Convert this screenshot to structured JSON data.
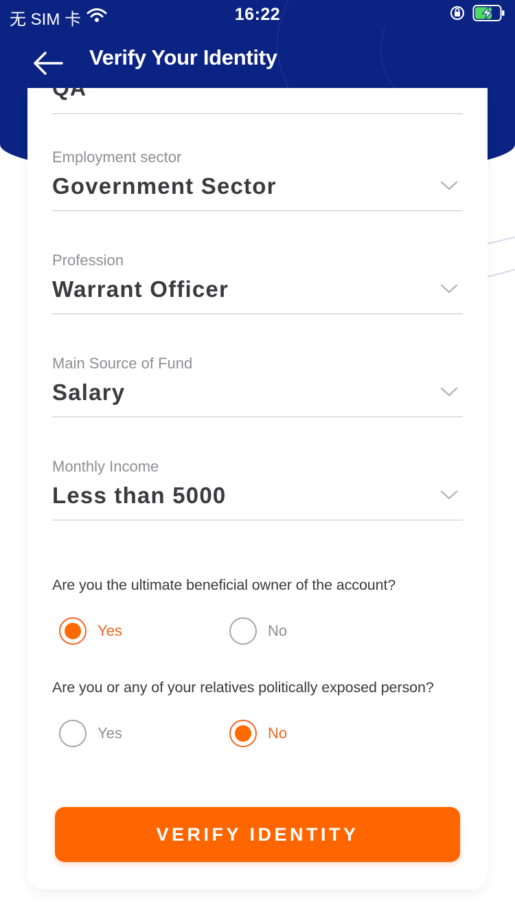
{
  "status_bar": {
    "carrier": "无 SIM 卡",
    "time": "16:22",
    "wifi_icon": "wifi-icon",
    "rotation_lock_icon": "rotation-lock-icon",
    "battery_icon": "battery-charging-icon"
  },
  "header": {
    "title": "Verify Your Identity",
    "back_icon": "arrow-left-icon",
    "background_color": "#0b2382"
  },
  "form": {
    "previous_field_value": "QA",
    "fields": [
      {
        "label": "Employment sector",
        "value": "Government Sector"
      },
      {
        "label": "Profession",
        "value": "Warrant Officer"
      },
      {
        "label": "Main Source of Fund",
        "value": "Salary"
      },
      {
        "label": "Monthly Income",
        "value": "Less than 5000"
      }
    ],
    "questions": [
      {
        "text": "Are you the ultimate beneficial owner of the account?",
        "yes_label": "Yes",
        "no_label": "No",
        "selected": "Yes"
      },
      {
        "text": "Are you or any of your relatives politically exposed person?",
        "yes_label": "Yes",
        "no_label": "No",
        "selected": "No"
      }
    ]
  },
  "verify_button": {
    "label": "VERIFY IDENTITY",
    "color": "#ff6600"
  },
  "accent_color": "#f26522"
}
